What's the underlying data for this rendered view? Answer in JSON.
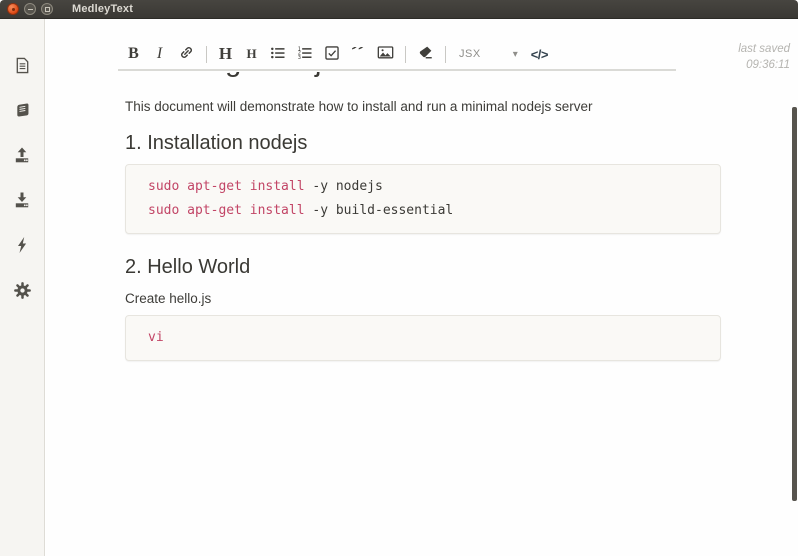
{
  "window": {
    "title": "MedleyText"
  },
  "sidebar": {
    "icons": [
      "document-icon",
      "book-icon",
      "upload-icon",
      "download-icon",
      "lightning-icon",
      "gear-icon"
    ]
  },
  "toolbar": {
    "bold_label": "B",
    "italic_label": "I",
    "heading_large_label": "H",
    "heading_small_label": "H",
    "icon_buttons": [
      "link-icon",
      "list-ul-icon",
      "list-ol-icon",
      "checklist-icon",
      "quote-icon",
      "image-icon",
      "eraser-icon"
    ],
    "language_value": "JSX",
    "code_toggle_label": "</>"
  },
  "glyphs": {
    "quote": "”",
    "chevron_down": "▾"
  },
  "status": {
    "last_saved_label": "last saved",
    "last_saved_time": "09:36:11"
  },
  "document": {
    "title_clipped": "Installing nodejs",
    "intro": "This document will demonstrate how to install and run a minimal nodejs server",
    "sections": [
      {
        "heading": "1. Installation nodejs",
        "code_lines": [
          {
            "keyword": "sudo apt-get install",
            "rest": " -y nodejs"
          },
          {
            "keyword": "sudo apt-get install",
            "rest": " -y build-essential"
          }
        ]
      },
      {
        "heading": "2. Hello World",
        "paragraph": "Create hello.js",
        "code_lines": [
          {
            "keyword": "vi",
            "rest": ""
          }
        ]
      }
    ]
  },
  "colors": {
    "titlebar": "#3c3a36",
    "close_button": "#dd4814",
    "sidebar_background": "#f6f5f2",
    "code_background": "#faf9f6",
    "code_keyword": "#c24566",
    "code_text": "#3b3a36"
  }
}
